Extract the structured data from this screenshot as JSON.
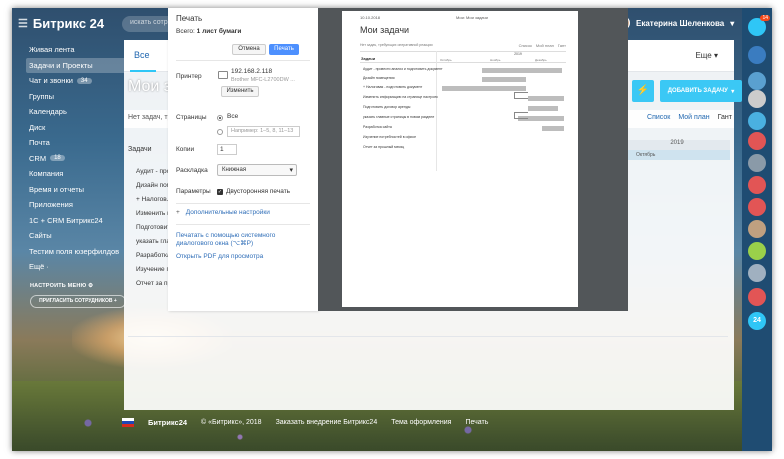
{
  "header": {
    "logo": "Битрикс 24",
    "search_placeholder": "искать сотр...",
    "user_name": "Екатерина Шеленкова"
  },
  "sidebar": {
    "items": [
      {
        "label": "Живая лента"
      },
      {
        "label": "Задачи и Проекты",
        "active": true
      },
      {
        "label": "Чат и звонки",
        "count": "34"
      },
      {
        "label": "Группы"
      },
      {
        "label": "Календарь"
      },
      {
        "label": "Диск"
      },
      {
        "label": "Почта"
      },
      {
        "label": "CRM",
        "count": "18"
      },
      {
        "label": "Компания"
      },
      {
        "label": "Время и отчеты"
      },
      {
        "label": "Приложения"
      },
      {
        "label": "1С + CRM Битрикс24"
      },
      {
        "label": "Сайты"
      },
      {
        "label": "Тестим поля юзерфилдов"
      },
      {
        "label": "Ещё ·"
      }
    ],
    "settings_label": "НАСТРОИТЬ МЕНЮ",
    "invite_label": "ПРИГЛАСИТЬ СОТРУДНИКОВ"
  },
  "main": {
    "tab_all": "Все",
    "more": "Еще",
    "page_title": "Мои за...",
    "add_task": "ДОБАВИТЬ ЗАДАЧУ",
    "no_filter": "Нет задач, тре...",
    "views": [
      "Список",
      "Мой план",
      "Гант"
    ],
    "tasks_header": "Задачи",
    "year": "2019",
    "month": "Октябрь",
    "tasks": [
      "Аудит - прое...",
      "Дизайн пом...",
      "+ Налогов...",
      "Изменить ин...",
      "Подготовит...",
      "указать глав...",
      "Разработка...",
      "Изучение по...",
      "Отчет за пр..."
    ]
  },
  "footer": {
    "logo": "Битрикс24",
    "copyright": "© «Битрикс», 2018",
    "order": "Заказать внедрение Битрикс24",
    "theme": "Тема оформления",
    "print": "Печать"
  },
  "print_dialog": {
    "title": "Печать",
    "total_label": "Всего:",
    "total_value": "1 лист бумаги",
    "cancel": "Отмена",
    "print": "Печать",
    "printer_label": "Принтер",
    "printer_ip": "192.168.2.118",
    "printer_model": "Brother MFC-L2700DW ...",
    "change": "Изменить",
    "pages_label": "Страницы",
    "pages_all": "Все",
    "pages_placeholder": "Например: 1–5, 8, 11–13",
    "copies_label": "Копии",
    "copies_value": "1",
    "layout_label": "Раскладка",
    "layout_value": "Книжная",
    "params_label": "Параметры",
    "duplex": "Двусторонняя печать",
    "more_settings": "Дополнительные настройки",
    "system_dialog": "Печатать с помощью системного диалогового окна (⌥⌘P)",
    "open_pdf": "Открыть PDF для просмотра"
  },
  "preview": {
    "date": "10.10.2018",
    "header_title": "Мои: Мои задачи",
    "title": "Мои задачи",
    "no_filter": "Нет задач, требующих оперативной реакции",
    "views": [
      "Список",
      "Мой план",
      "Гант"
    ],
    "tasks_header": "Задачи",
    "year": "2019",
    "months": [
      "Октябрь",
      "Ноябрь",
      "Декабрь"
    ],
    "tasks": [
      "Аудит - провести анализ и подготовить документ",
      "Дизайн помещения",
      "+ Налоговая - подготовить документ",
      "Изменить информацию на странице настроек",
      "Подготовить договор аренды",
      "указать главные страницы в новом разделе",
      "Разработка сайта",
      "Изучение потребностей в офисе",
      "Отчет за прошлый месяц"
    ]
  },
  "colors": {
    "accent": "#3bc8f5",
    "link": "#2067b0",
    "print_button": "#4d90fe",
    "badge": "#f54819"
  }
}
